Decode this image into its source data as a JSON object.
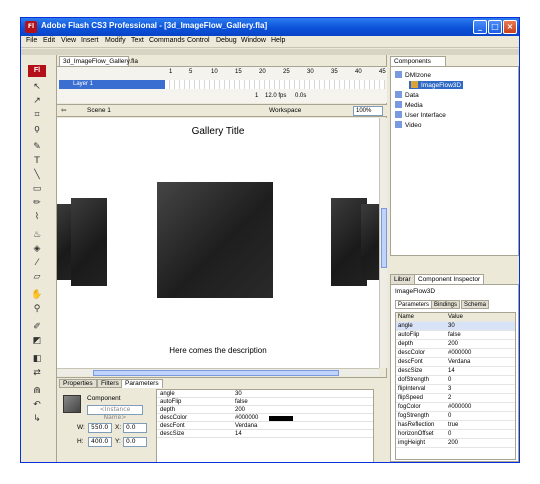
{
  "window": {
    "title": "Adobe Flash CS3 Professional - [3d_ImageFlow_Gallery.fla]",
    "app_badge": "Fl"
  },
  "menu": [
    "File",
    "Edit",
    "View",
    "Insert",
    "Modify",
    "Text",
    "Commands",
    "Control",
    "Debug",
    "Window",
    "Help"
  ],
  "tools": {
    "badge": "Fl"
  },
  "document": {
    "tab": "3d_ImageFlow_Gallery.fla",
    "layer_name": "Layer 1",
    "ruler": [
      "1",
      "5",
      "10",
      "15",
      "20",
      "25",
      "30",
      "35",
      "40",
      "45"
    ],
    "status_frame": "1",
    "status_fps": "12.0 fps",
    "status_time": "0.0s",
    "scene": "Scene 1",
    "workspace": "Workspace",
    "zoom": "100%",
    "gallery_title": "Gallery Title",
    "gallery_desc": "Here comes the description"
  },
  "properties": {
    "tabs": [
      "Properties",
      "Filters",
      "Parameters"
    ],
    "component_label": "Component",
    "instance_placeholder": "<Instance Name>",
    "w_label": "W:",
    "w": "550.0",
    "h_label": "H:",
    "h": "400.0",
    "x_label": "X:",
    "x": "0.0",
    "y_label": "Y:",
    "y": "0.0",
    "rows": [
      {
        "name": "angle",
        "value": "30"
      },
      {
        "name": "autoFlip",
        "value": "false"
      },
      {
        "name": "depth",
        "value": "200"
      },
      {
        "name": "descColor",
        "value": "#000000"
      },
      {
        "name": "descFont",
        "value": "Verdana"
      },
      {
        "name": "descSize",
        "value": "14"
      }
    ]
  },
  "components_panel": {
    "tab": "Components",
    "tree": [
      "DMIzone",
      "ImageFlow3D",
      "Data",
      "Media",
      "User Interface",
      "Video"
    ]
  },
  "inspector": {
    "tabs": [
      "Librar",
      "Component Inspector"
    ],
    "component": "ImageFlow3D",
    "subtabs": [
      "Parameters",
      "Bindings",
      "Schema"
    ],
    "col_name": "Name",
    "col_value": "Value",
    "rows": [
      {
        "name": "angle",
        "value": "30"
      },
      {
        "name": "autoFlip",
        "value": "false"
      },
      {
        "name": "depth",
        "value": "200"
      },
      {
        "name": "descColor",
        "value": "#000000"
      },
      {
        "name": "descFont",
        "value": "Verdana"
      },
      {
        "name": "descSize",
        "value": "14"
      },
      {
        "name": "dofStrength",
        "value": "0"
      },
      {
        "name": "flipInterval",
        "value": "3"
      },
      {
        "name": "flipSpeed",
        "value": "2"
      },
      {
        "name": "fogColor",
        "value": "#000000"
      },
      {
        "name": "fogStrength",
        "value": "0"
      },
      {
        "name": "hasReflection",
        "value": "true"
      },
      {
        "name": "horizonOffset",
        "value": "0"
      },
      {
        "name": "imgHeight",
        "value": "200"
      }
    ]
  },
  "colors": {
    "titlebar": "#0b52d8",
    "selection": "#316ac5"
  }
}
